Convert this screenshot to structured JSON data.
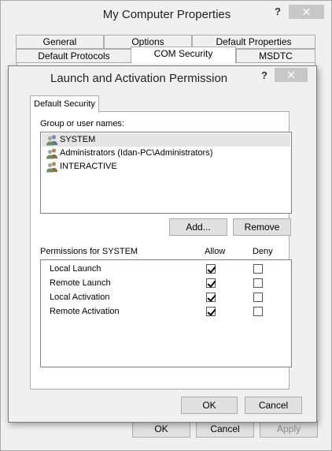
{
  "outer": {
    "title": "My Computer Properties",
    "help": "?",
    "close": "✕",
    "tabs_row1": [
      "General",
      "Options",
      "Default Properties"
    ],
    "tabs_row2": [
      "Default Protocols",
      "COM Security",
      "MSDTC"
    ],
    "buttons": {
      "ok": "OK",
      "cancel": "Cancel",
      "apply": "Apply"
    }
  },
  "dialog": {
    "title": "Launch and Activation Permission",
    "help": "?",
    "close": "✕",
    "tab": "Default Security",
    "group_label": "Group or user names:",
    "users": [
      {
        "name": "SYSTEM",
        "selected": true
      },
      {
        "name": "Administrators (Idan-PC\\Administrators)",
        "selected": false
      },
      {
        "name": "INTERACTIVE",
        "selected": false
      }
    ],
    "add_label": "Add...",
    "remove_label": "Remove",
    "permissions_label": "Permissions for SYSTEM",
    "allow_header": "Allow",
    "deny_header": "Deny",
    "permissions": [
      {
        "name": "Local Launch",
        "allow": true,
        "deny": false
      },
      {
        "name": "Remote Launch",
        "allow": true,
        "deny": false
      },
      {
        "name": "Local Activation",
        "allow": true,
        "deny": false
      },
      {
        "name": "Remote Activation",
        "allow": true,
        "deny": false
      }
    ],
    "ok_label": "OK",
    "cancel_label": "Cancel"
  }
}
